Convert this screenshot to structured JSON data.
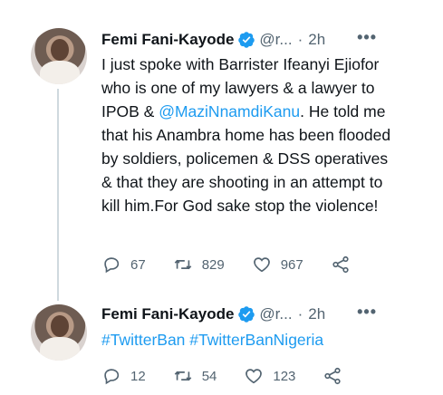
{
  "tweets": [
    {
      "name": "Femi Fani-Kayode",
      "handle": "@r...",
      "separator": "·",
      "time": "2h",
      "more": "•••",
      "text_before": "I just spoke with Barrister Ifeanyi Ejiofor who is one of my lawyers & a lawyer to IPOB & ",
      "mention": "@MaziNnamdiKanu",
      "text_after": ". He told me that his Anambra home has been flooded by soldiers, policemen & DSS operatives & that they are shooting in an attempt to kill him.For God sake stop the violence!",
      "replies": "67",
      "retweets": "829",
      "likes": "967"
    },
    {
      "name": "Femi Fani-Kayode",
      "handle": "@r...",
      "separator": "·",
      "time": "2h",
      "more": "•••",
      "hashtags": "#TwitterBan #TwitterBanNigeria",
      "replies": "12",
      "retweets": "54",
      "likes": "123"
    }
  ],
  "colors": {
    "accent": "#1d9bf0",
    "muted": "#536471",
    "text": "#0f1419",
    "thread_line": "#cfd9de"
  },
  "icons": [
    "verified-badge-icon",
    "reply-icon",
    "retweet-icon",
    "like-icon",
    "share-icon",
    "more-icon"
  ]
}
